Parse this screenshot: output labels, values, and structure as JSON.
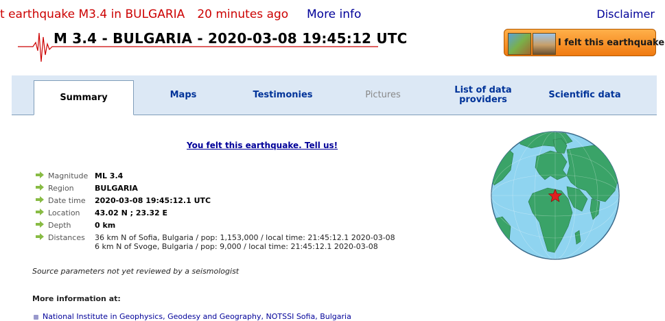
{
  "top": {
    "ticker_text": "t earthquake M3.4 in BULGARIA",
    "ticker_ago": "20 minutes ago",
    "more_info": "More info",
    "disclaimer": "Disclaimer"
  },
  "header": {
    "title": "M 3.4 - BULGARIA - 2020-03-08 19:45:12 UTC",
    "felt_button": "I felt this earthquake"
  },
  "tabs": [
    {
      "label": "Summary",
      "state": "active"
    },
    {
      "label": "Maps",
      "state": "normal"
    },
    {
      "label": "Testimonies",
      "state": "normal"
    },
    {
      "label": "Pictures",
      "state": "disabled"
    },
    {
      "label": "List of data providers",
      "state": "normal"
    },
    {
      "label": "Scientific data",
      "state": "normal"
    }
  ],
  "summary": {
    "tell_us": "You felt this earthquake. Tell us!",
    "params": [
      {
        "key": "Magnitude",
        "value": "ML 3.4"
      },
      {
        "key": "Region",
        "value": "BULGARIA"
      },
      {
        "key": "Date time",
        "value": "2020-03-08 19:45:12.1 UTC"
      },
      {
        "key": "Location",
        "value": "43.02 N ; 23.32 E"
      },
      {
        "key": "Depth",
        "value": "0 km"
      }
    ],
    "distances_label": "Distances",
    "distances": [
      "36 km N of Sofia, Bulgaria / pop: 1,153,000 / local time: 21:45:12.1 2020-03-08",
      "6 km N of Svoge, Bulgaria / pop: 9,000 / local time: 21:45:12.1 2020-03-08"
    ],
    "source_note": "Source parameters not yet reviewed by a seismologist",
    "more_info_at": "More information at:",
    "institute": "National Institute in Geophysics, Geodesy and Geography, NOTSSI Sofia, Bulgaria"
  },
  "colors": {
    "ticker": "#cc0000",
    "link": "#000099",
    "tabbar_bg": "#dce8f5",
    "felt_button": "#f07a10",
    "ocean": "#8fd4f0",
    "land": "#3aa368",
    "epicenter": "#e02020"
  },
  "icons": {
    "seismogram": "seismogram-icon",
    "arrow": "green-arrow-icon",
    "globe": "globe-map",
    "epicenter": "star-icon"
  }
}
